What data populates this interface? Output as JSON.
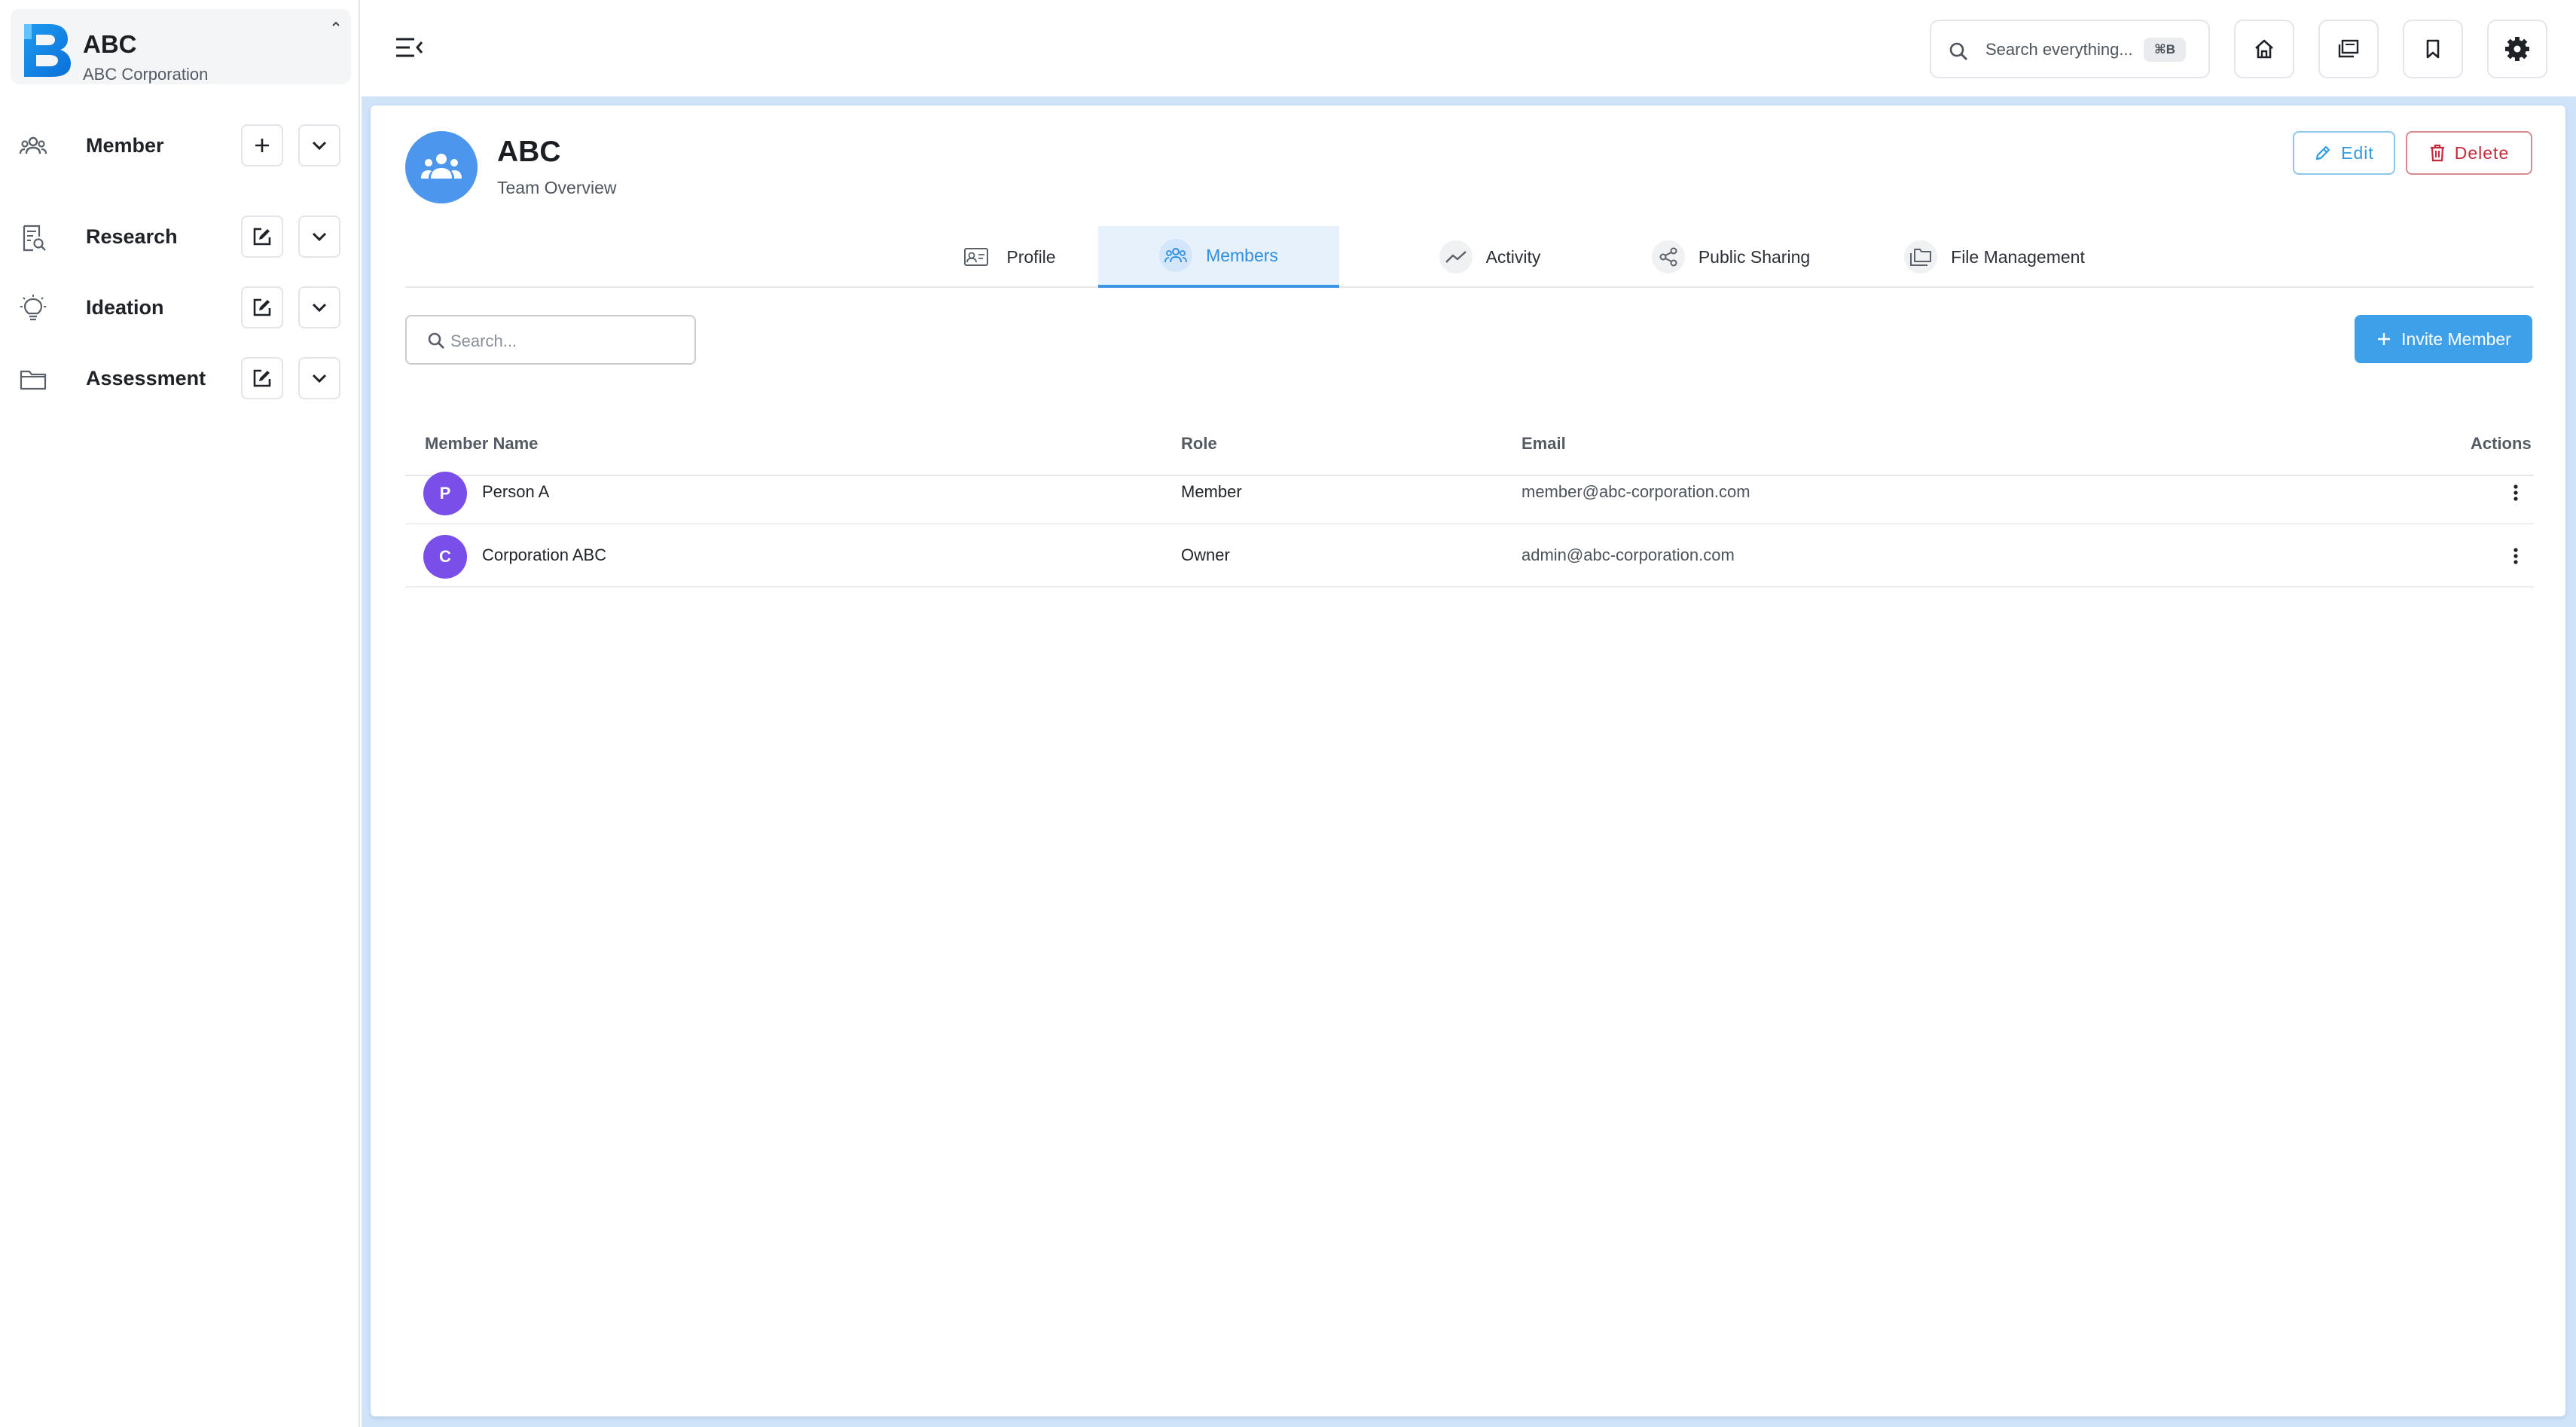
{
  "brand": {
    "name": "ABC",
    "subtitle": "ABC Corporation"
  },
  "sidebar": {
    "items": [
      {
        "label": "Member"
      },
      {
        "label": "Research"
      },
      {
        "label": "Ideation"
      },
      {
        "label": "Assessment"
      }
    ]
  },
  "topbar": {
    "search_placeholder": "Search everything...",
    "search_shortcut": "⌘B"
  },
  "team": {
    "name": "ABC",
    "subtitle": "Team Overview"
  },
  "actions": {
    "edit_label": "Edit",
    "delete_label": "Delete"
  },
  "tabs": [
    {
      "label": "Profile"
    },
    {
      "label": "Members",
      "active": true
    },
    {
      "label": "Activity"
    },
    {
      "label": "Public Sharing"
    },
    {
      "label": "File Management"
    }
  ],
  "members": {
    "search_placeholder": "Search...",
    "invite_label": "Invite Member",
    "columns": {
      "name": "Member Name",
      "role": "Role",
      "email": "Email",
      "actions": "Actions"
    },
    "rows": [
      {
        "initial": "P",
        "name": "Person A",
        "role": "Member",
        "email": "member@abc-corporation.com"
      },
      {
        "initial": "C",
        "name": "Corporation ABC",
        "role": "Owner",
        "email": "admin@abc-corporation.com"
      }
    ]
  },
  "colors": {
    "accent": "#3fa0ea",
    "danger": "#c4283a",
    "avatar": "#7a4ee8",
    "team_avatar": "#4d96ed",
    "page_bg": "#cfe3f9"
  }
}
